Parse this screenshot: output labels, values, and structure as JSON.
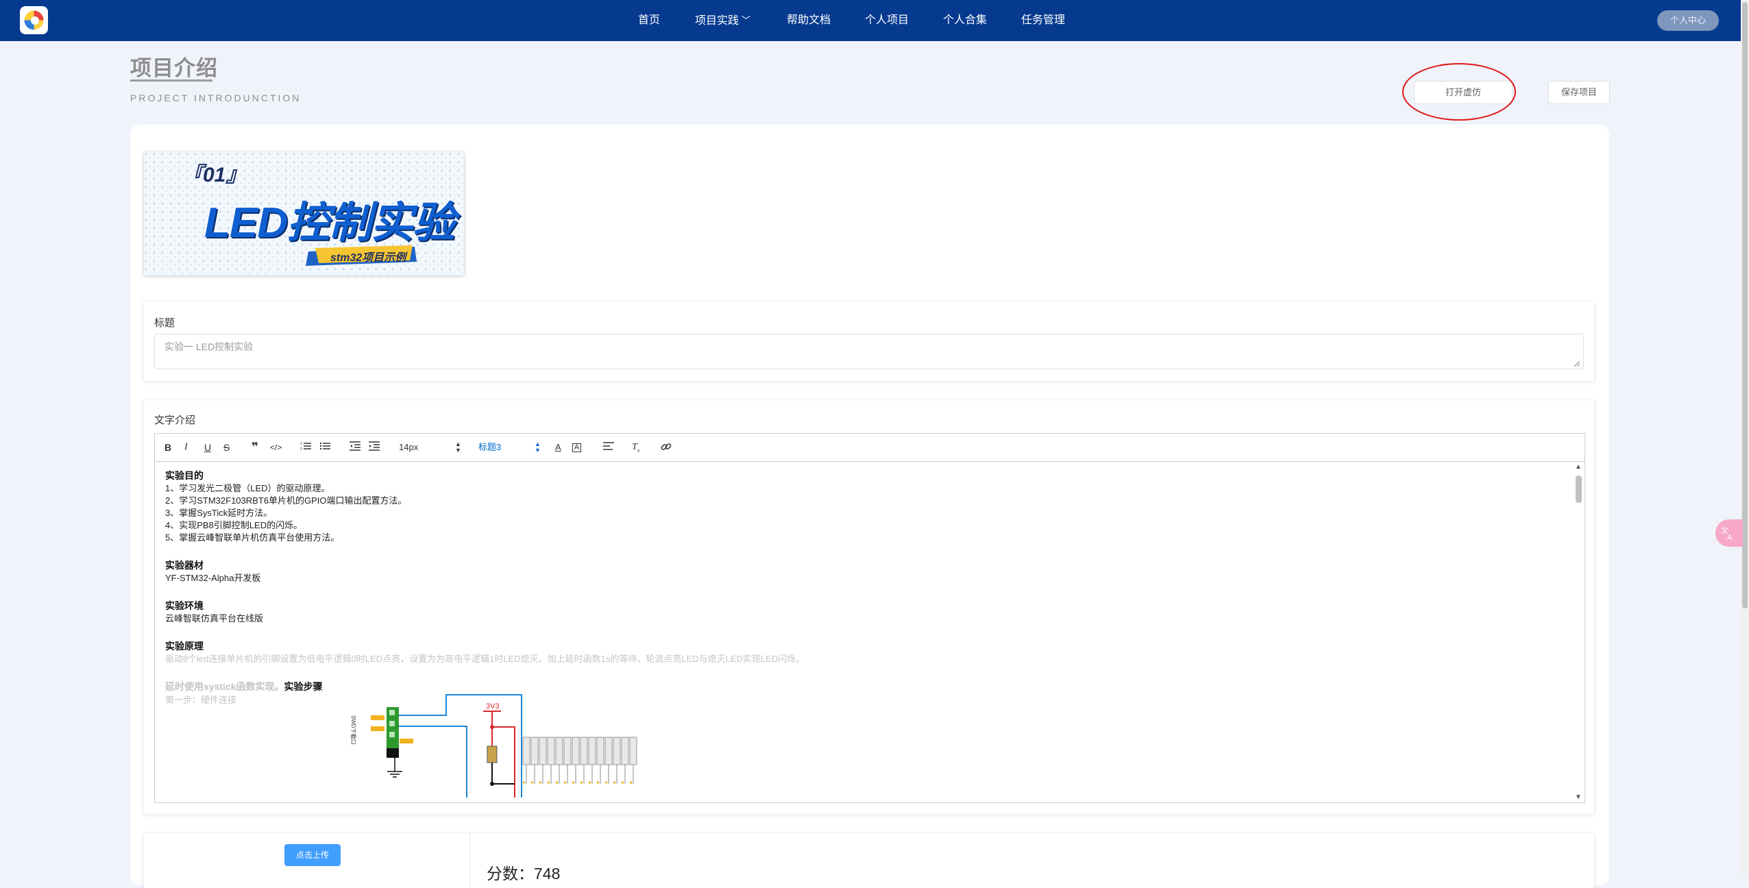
{
  "nav": {
    "items": [
      {
        "label": "首页"
      },
      {
        "label": "项目实践"
      },
      {
        "label": "帮助文档"
      },
      {
        "label": "个人项目"
      },
      {
        "label": "个人合集"
      },
      {
        "label": "任务管理"
      }
    ],
    "user_center": "个人中心"
  },
  "header": {
    "title": "项目介绍",
    "subtitle": "PROJECT INTRODUNCTION",
    "open_sim_button": "打开虚仿",
    "save_button": "保存项目"
  },
  "cover": {
    "number": "『01』",
    "title": "LED控制实验",
    "tag": "stm32项目示例"
  },
  "title_section": {
    "label": "标题",
    "placeholder": "实验一 LED控制实验"
  },
  "intro_section": {
    "label": "文字介绍",
    "toolbar": {
      "font_size": "14px",
      "heading": "标题3"
    },
    "content": {
      "h1": "实验目的",
      "goals": [
        "1、学习发光二极管（LED）的驱动原理。",
        "2、学习STM32F103RBT6单片机的GPIO端口输出配置方法。",
        "3、掌握SysTick延时方法。",
        "4、实现PB8引脚控制LED的闪烁。",
        "5、掌握云峰智联单片机仿真平台使用方法。"
      ],
      "h2": "实验器材",
      "equipment": "YF-STM32-Alpha开发板",
      "h3": "实验环境",
      "environment": "云峰智联仿真平台在线版",
      "h4": "实验原理",
      "principle": "驱动8个led连接单片机的引脚设置为低电平逻辑0时LED点亮，设置为为高电平逻辑1时LED熄灭。加上延时函数1s的等待，轮流点亮LED与熄灭LED实现LED闪烁。",
      "delay_note": "延时使用systick函数实现。",
      "h5": "实验步骤",
      "step1": "第一步：硬件连接",
      "diagram": {
        "power_label": "3V3",
        "header_label": "SWD下载口"
      }
    }
  },
  "upload": {
    "button": "点击上传"
  },
  "score": {
    "text": "分数：748"
  },
  "colors": {
    "nav_bg": "#053a8f",
    "accent": "#409eff",
    "annotation": "#e01616"
  }
}
